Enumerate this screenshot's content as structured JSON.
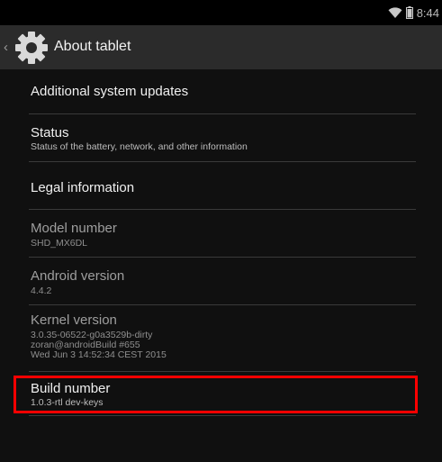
{
  "status_bar": {
    "time": "8:44",
    "icons": [
      "wifi-icon",
      "battery-icon"
    ]
  },
  "action_bar": {
    "title": "About tablet",
    "icon": "settings-gear-icon",
    "up_icon": "chevron-left-icon"
  },
  "items": [
    {
      "title": "Additional system updates",
      "subtitle": null,
      "clickable": true
    },
    {
      "title": "Status",
      "subtitle": "Status of the battery, network, and other information",
      "clickable": true
    },
    {
      "title": "Legal information",
      "subtitle": null,
      "clickable": true
    },
    {
      "title": "Model number",
      "subtitle": "SHD_MX6DL",
      "clickable": false
    },
    {
      "title": "Android version",
      "subtitle": "4.4.2",
      "clickable": false
    },
    {
      "title": "Kernel version",
      "subtitle_lines": [
        "3.0.35-06522-g0a3529b-dirty",
        "zoran@androidBuild #655",
        "Wed Jun 3 14:52:34 CEST 2015"
      ],
      "clickable": false
    },
    {
      "title": "Build number",
      "subtitle": "1.0.3-rtl dev-keys",
      "clickable": true,
      "highlighted": true
    }
  ],
  "colors": {
    "background": "#101010",
    "action_bar": "#2b2b2b",
    "highlight": "#ff0000",
    "divider": "#3a3a3a"
  }
}
